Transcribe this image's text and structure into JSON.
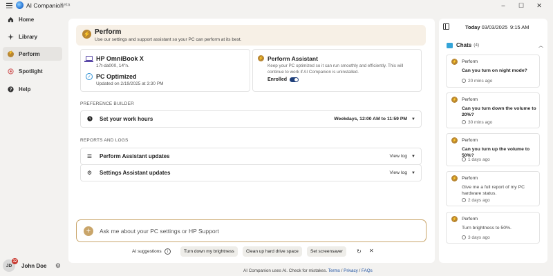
{
  "window": {
    "title": "AI Companion",
    "badge": "Beta",
    "minimize": "–",
    "maximize": "☐",
    "close": "✕"
  },
  "sidebar": {
    "items": [
      {
        "label": "Home",
        "icon": "home-icon"
      },
      {
        "label": "Library",
        "icon": "sparkle-icon"
      },
      {
        "label": "Perform",
        "icon": "bolt-icon",
        "active": true
      },
      {
        "label": "Spotlight",
        "icon": "spotlight-icon"
      },
      {
        "label": "Help",
        "icon": "help-icon"
      }
    ],
    "user": {
      "initials": "JD",
      "notifications": "32",
      "name": "John Doe"
    }
  },
  "banner": {
    "title": "Perform",
    "subtitle": "Use our settings and support assistant so your PC can perform at its best."
  },
  "device": {
    "name": "HP OmniBook X",
    "model": "17t-da000, 14\"n.",
    "status_title": "PC Optimized",
    "updated": "Updated on 2/19/2025 at 3:30 PM"
  },
  "assistant": {
    "title": "Perform Assistant",
    "description": "Keep your PC optimized so it can run smoothly and efficiently. This will continue to work if AI Companion is uninstalled.",
    "enrolled_label": "Enrolled",
    "enrolled": true
  },
  "preference_builder": {
    "section": "PREFERENCE BUILDER",
    "label": "Set your work hours",
    "value": "Weekdays, 12:00 AM to 11:59 PM"
  },
  "reports": {
    "section": "REPORTS AND LOGS",
    "items": [
      {
        "label": "Perform Assistant updates",
        "action": "View log"
      },
      {
        "label": "Settings Assistant updates",
        "action": "View log"
      }
    ]
  },
  "ask": {
    "placeholder": "Ask me about your PC settings or HP Support"
  },
  "suggestions": {
    "label": "AI suggestions",
    "chips": [
      "Turn down my brightness",
      "Clean up hard drive space",
      "Set screensaver"
    ]
  },
  "footer": {
    "text": "AI Companion uses AI. Check for mistakes.",
    "links": [
      "Terms",
      "Privacy",
      "FAQs"
    ],
    "separator": " / "
  },
  "right_panel": {
    "today_label": "Today",
    "date": "03/03/2025",
    "time": "9:15 AM",
    "chats_title": "Chats",
    "chats_count": "(4)",
    "chats": [
      {
        "source": "Perform",
        "question": "Can you turn on night mode?",
        "time": "20 mins ago"
      },
      {
        "source": "Perform",
        "question": "Can you turn down the volume to 20%?",
        "time": "30 mins ago"
      },
      {
        "source": "Perform",
        "question": "Can you turn up the volume to 50%?",
        "time": "1 days ago"
      },
      {
        "source": "Perform",
        "question": "Give me a full report of my PC hardware status.",
        "time": "2 days ago"
      },
      {
        "source": "Perform",
        "question": "Turn brightness to 50%.",
        "time": "3 days ago"
      }
    ]
  },
  "colors": {
    "accent_gold": "#b88632",
    "toggle": "#1f3f7a",
    "link": "#1b4fa0",
    "badge_red": "#c8372d"
  }
}
